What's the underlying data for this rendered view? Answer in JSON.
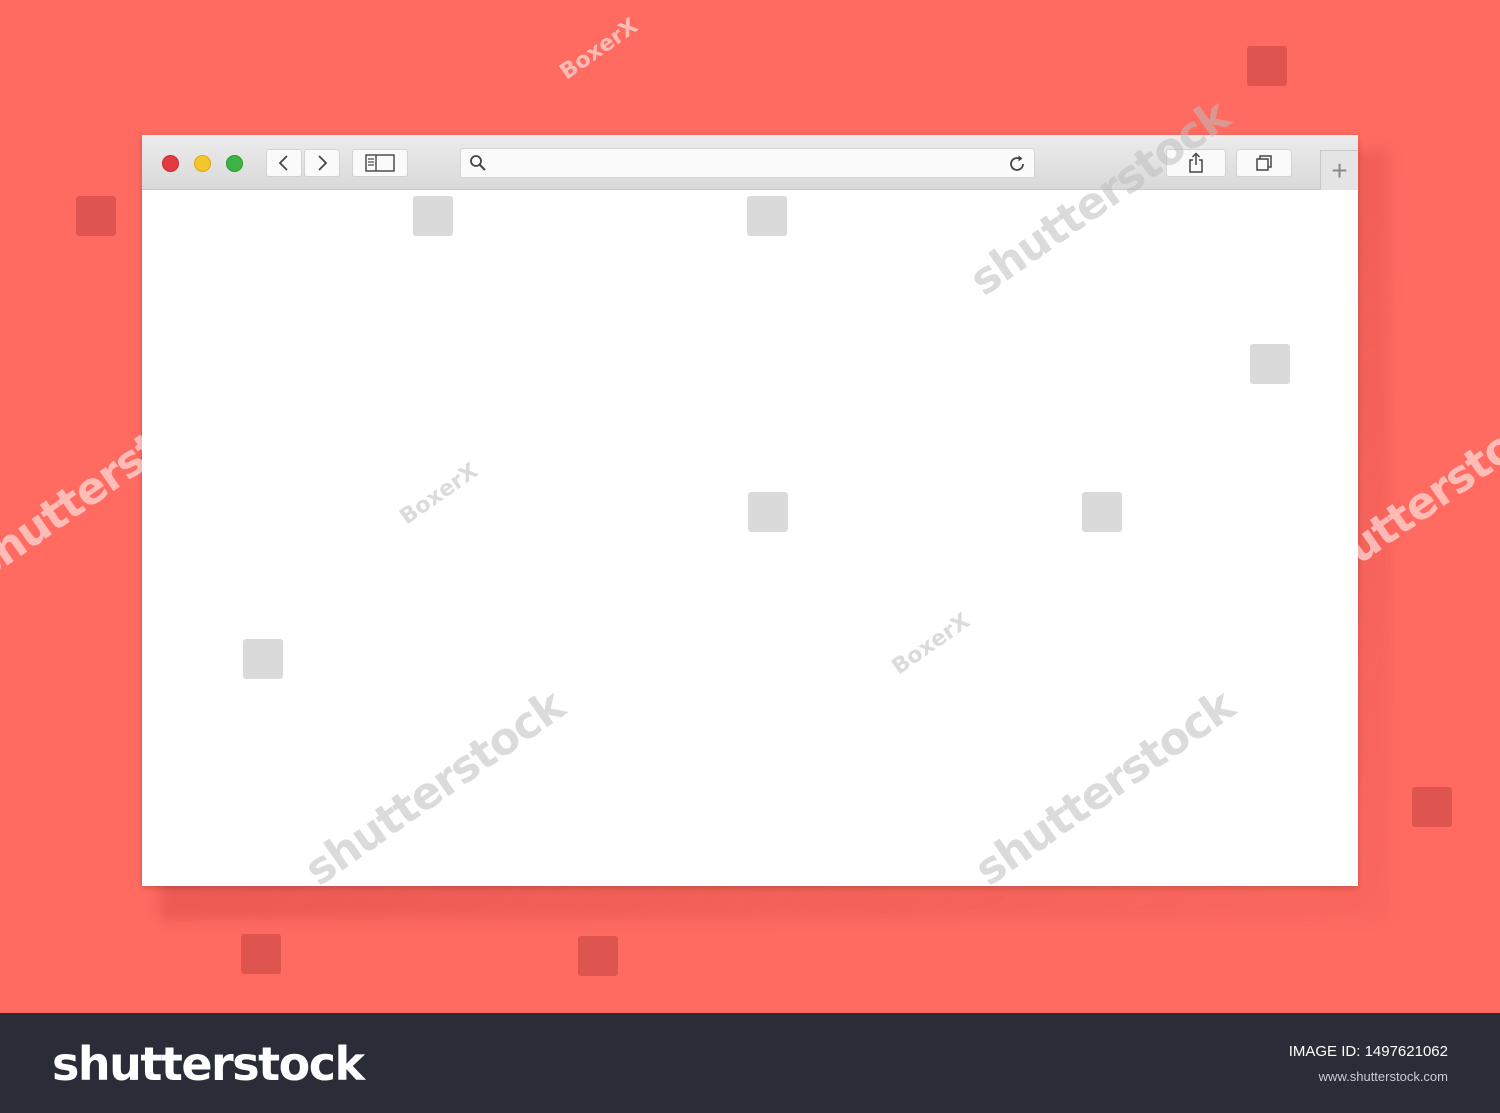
{
  "background_color": "#ff6b61",
  "browser": {
    "traffic_lights": [
      {
        "name": "close",
        "color": "#e33a3f"
      },
      {
        "name": "minimize",
        "color": "#f5c52c"
      },
      {
        "name": "maximize",
        "color": "#3cb544"
      }
    ],
    "toolbar_icons": [
      "chevron-left-icon",
      "chevron-right-icon",
      "sidebar-icon",
      "search-icon",
      "reload-icon",
      "share-icon",
      "tabs-overview-icon"
    ],
    "address_bar": {
      "value": "",
      "placeholder": ""
    },
    "new_tab_label": "+"
  },
  "watermarks": {
    "stock": "shutterstock",
    "author": "BoxerX"
  },
  "footer": {
    "brand": "shutterstock",
    "image_id_label": "IMAGE ID:",
    "image_id_value": "1497621062",
    "site": "www.shutterstock.com"
  }
}
